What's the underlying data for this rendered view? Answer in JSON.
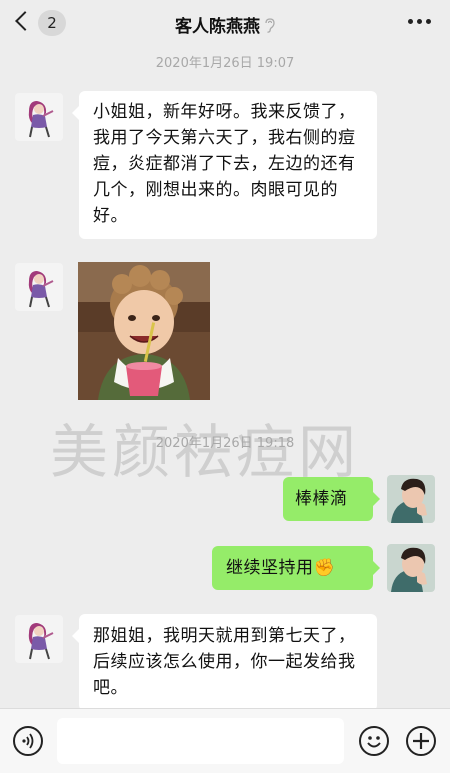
{
  "header": {
    "back_badge": "2",
    "title": "客人陈燕燕"
  },
  "messages": {
    "timestamp_1": "2020年1月26日 19:07",
    "msg_1": "小姐姐，新年好呀。我来反馈了，我用了今天第六天了，我右侧的痘痘，炎症都消了下去，左边的还有几个，刚想出来的。肉眼可见的好。",
    "timestamp_2": "2020年1月26日 19:18",
    "msg_2": "棒棒滴",
    "msg_3": "继续坚持用",
    "msg_3_emoji": "✊",
    "msg_4": "那姐姐，我明天就用到第七天了，后续应该怎么使用，你一起发给我吧。"
  },
  "watermark": "美颜祛痘网",
  "icons": {
    "back": "chevron-left-icon",
    "ear": "earpiece-icon",
    "more": "more-dots-icon",
    "voice": "voice-icon",
    "emoji": "emoji-icon",
    "add": "plus-icon"
  },
  "colors": {
    "background": "#ededed",
    "incoming_bubble": "#ffffff",
    "outgoing_bubble": "#95ec69",
    "timestamp": "#a8a8a8"
  }
}
